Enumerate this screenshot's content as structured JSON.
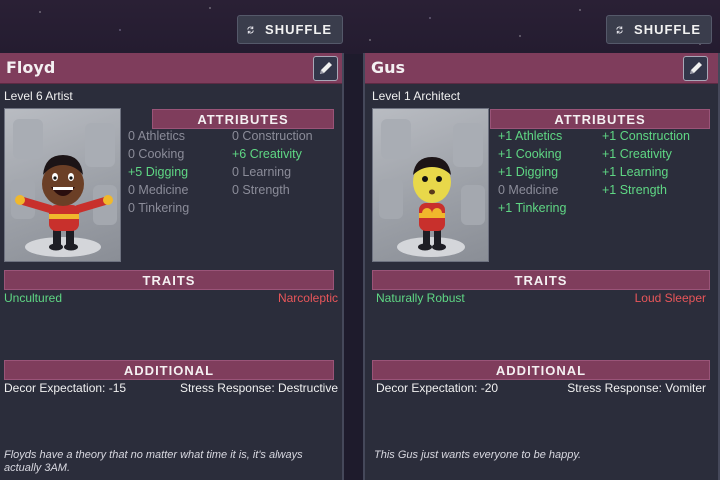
{
  "colors": {
    "background": "#1e1b2c",
    "panel": "#2b2d3b",
    "header_bar": "#7f3d5c",
    "positive": "#5fd784",
    "neutral": "#8b8c99",
    "negative": "#e8565a"
  },
  "icons": {
    "shuffle": "shuffle-icon",
    "edit": "pencil-icon"
  },
  "cards": [
    {
      "shuffle_label": "SHUFFLE",
      "name": "Floyd",
      "role": "Level 6 Artist",
      "attributes_header": "ATTRIBUTES",
      "attributes": [
        {
          "text": "0 Athletics",
          "value": 0
        },
        {
          "text": "0 Construction",
          "value": 0
        },
        {
          "text": "0 Cooking",
          "value": 0
        },
        {
          "text": "+6 Creativity",
          "value": 6
        },
        {
          "text": "+5 Digging",
          "value": 5
        },
        {
          "text": "0 Learning",
          "value": 0
        },
        {
          "text": "0 Medicine",
          "value": 0
        },
        {
          "text": "0 Strength",
          "value": 0
        },
        {
          "text": "0 Tinkering",
          "value": 0
        }
      ],
      "traits_header": "TRAITS",
      "trait_positive": "Uncultured",
      "trait_negative": "Narcoleptic",
      "additional_header": "ADDITIONAL",
      "decor": "Decor Expectation: -15",
      "stress": "Stress Response: Destructive",
      "flavor": "Floyds have a theory that no matter what time it is, it's always actually 3AM."
    },
    {
      "shuffle_label": "SHUFFLE",
      "name": "Gus",
      "role": "Level 1 Architect",
      "attributes_header": "ATTRIBUTES",
      "attributes": [
        {
          "text": "+1 Athletics",
          "value": 1
        },
        {
          "text": "+1 Construction",
          "value": 1
        },
        {
          "text": "+1 Cooking",
          "value": 1
        },
        {
          "text": "+1 Creativity",
          "value": 1
        },
        {
          "text": "+1 Digging",
          "value": 1
        },
        {
          "text": "+1 Learning",
          "value": 1
        },
        {
          "text": "0 Medicine",
          "value": 0
        },
        {
          "text": "+1 Strength",
          "value": 1
        },
        {
          "text": "+1 Tinkering",
          "value": 1
        }
      ],
      "traits_header": "TRAITS",
      "trait_positive": "Naturally Robust",
      "trait_negative": "Loud Sleeper",
      "additional_header": "ADDITIONAL",
      "decor": "Decor Expectation: -20",
      "stress": "Stress Response: Vomiter",
      "flavor": "This Gus just wants everyone to be happy."
    }
  ]
}
